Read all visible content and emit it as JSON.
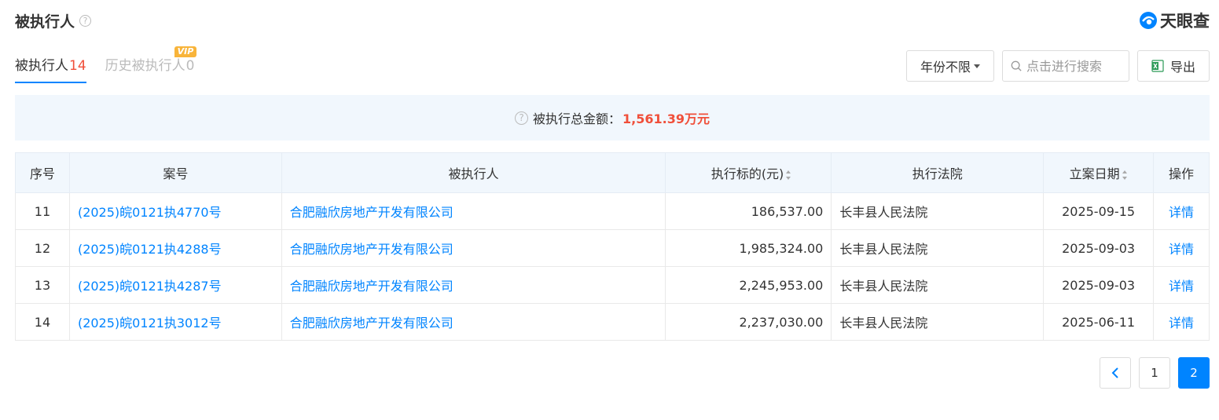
{
  "header": {
    "title": "被执行人",
    "help_glyph": "?",
    "logo_text": "天眼查"
  },
  "tabs": [
    {
      "label": "被执行人",
      "count": "14"
    },
    {
      "label": "历史被执行人",
      "count": "0",
      "badge": "VIP"
    }
  ],
  "toolbar": {
    "year_select": "年份不限",
    "search_placeholder": "点击进行搜索",
    "export_label": "导出"
  },
  "summary": {
    "label": "被执行总金额：",
    "amount": "1,561.39万元"
  },
  "table": {
    "columns": [
      "序号",
      "案号",
      "被执行人",
      "执行标的(元)",
      "执行法院",
      "立案日期",
      "操作"
    ],
    "rows": [
      {
        "idx": "11",
        "case_no": "(2025)皖0121执4770号",
        "party": "合肥融欣房地产开发有限公司",
        "amount": "186,537.00",
        "court": "长丰县人民法院",
        "date": "2025-09-15",
        "action": "详情"
      },
      {
        "idx": "12",
        "case_no": "(2025)皖0121执4288号",
        "party": "合肥融欣房地产开发有限公司",
        "amount": "1,985,324.00",
        "court": "长丰县人民法院",
        "date": "2025-09-03",
        "action": "详情"
      },
      {
        "idx": "13",
        "case_no": "(2025)皖0121执4287号",
        "party": "合肥融欣房地产开发有限公司",
        "amount": "2,245,953.00",
        "court": "长丰县人民法院",
        "date": "2025-09-03",
        "action": "详情"
      },
      {
        "idx": "14",
        "case_no": "(2025)皖0121执3012号",
        "party": "合肥融欣房地产开发有限公司",
        "amount": "2,237,030.00",
        "court": "长丰县人民法院",
        "date": "2025-06-11",
        "action": "详情"
      }
    ]
  },
  "pagination": {
    "prev_glyph": "‹",
    "pages": [
      "1",
      "2"
    ],
    "current": "2"
  },
  "colors": {
    "accent": "#0084ff",
    "count_red": "#f04f3a",
    "summary_bg": "#f1f7fd",
    "vip": "#f8b43a"
  }
}
